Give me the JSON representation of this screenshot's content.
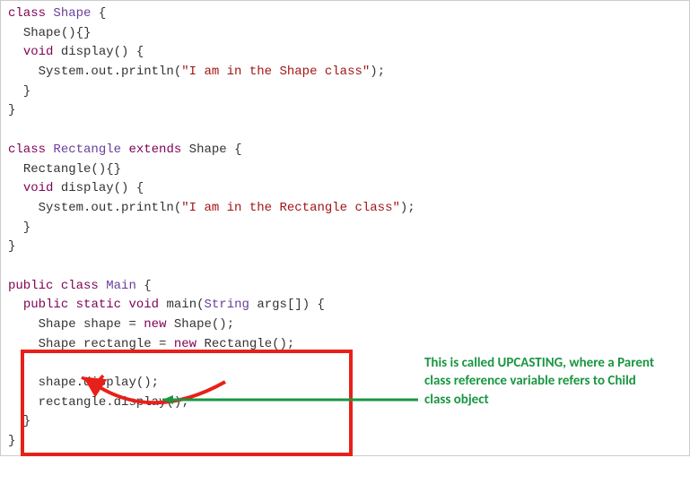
{
  "code": {
    "kw_class": "class",
    "kw_extends": "extends",
    "kw_public": "public",
    "kw_static": "static",
    "kw_void": "void",
    "kw_new": "new",
    "type_Shape": "Shape",
    "type_Rectangle": "Rectangle",
    "type_Main": "Main",
    "type_String": "String",
    "id_display": "display",
    "id_main": "main",
    "id_args": "args",
    "id_shape_var": "shape",
    "id_rectangle_var": "rectangle",
    "sys_out": "System.out.println",
    "str_shape": "\"I am in the Shape class\"",
    "str_rect": "\"I am in the Rectangle class\"",
    "ctor_shape": "Shape(){}",
    "ctor_rect": "Rectangle(){}"
  },
  "annotation": {
    "text": "This is called UPCASTING, where a Parent class reference variable refers to Child class object"
  }
}
